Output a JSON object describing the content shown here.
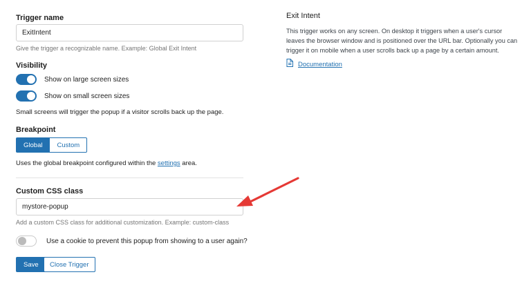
{
  "trigger_name": {
    "label": "Trigger name",
    "value": "ExitIntent",
    "help": "Give the trigger a recognizable name. Example: Global Exit Intent"
  },
  "visibility": {
    "label": "Visibility",
    "large_label": "Show on large screen sizes",
    "large_on": true,
    "small_label": "Show on small screen sizes",
    "small_on": true,
    "note": "Small screens will trigger the popup if a visitor scrolls back up the page."
  },
  "breakpoint": {
    "label": "Breakpoint",
    "options": [
      "Global",
      "Custom"
    ],
    "selected": "Global",
    "note_prefix": "Uses the global breakpoint configured within the ",
    "note_link": "settings",
    "note_suffix": " area."
  },
  "css_class": {
    "label": "Custom CSS class",
    "value": "mystore-popup",
    "help": "Add a custom CSS class for additional customization. Example: custom-class"
  },
  "cookie": {
    "label": "Use a cookie to prevent this popup from showing to a user again?",
    "on": false
  },
  "actions": {
    "save": "Save",
    "close": "Close Trigger"
  },
  "info": {
    "title": "Exit Intent",
    "description": "This trigger works on any screen. On desktop it triggers when a user's cursor leaves the browser window and is positioned over the URL bar. Optionally you can trigger it on mobile when a user scrolls back up a page by a certain amount.",
    "doc_link": "Documentation"
  },
  "colors": {
    "accent": "#2271b1",
    "annotation_arrow": "#e53935"
  },
  "icons": {
    "doc": "document-icon"
  }
}
